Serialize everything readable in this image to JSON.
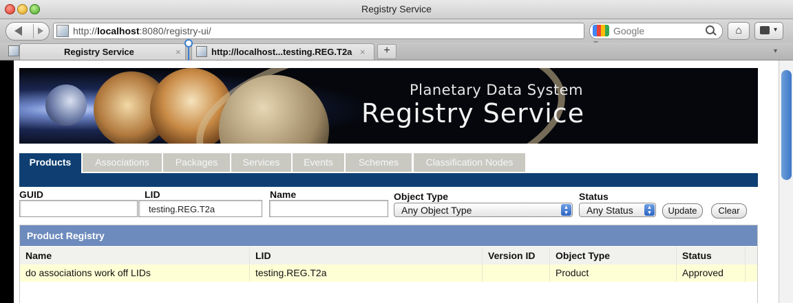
{
  "window": {
    "title": "Registry Service"
  },
  "nav": {
    "url_prefix": "http://",
    "url_host": "localhost",
    "url_rest": ":8080/registry-ui/",
    "search_placeholder": "Google",
    "icons": [
      "back-icon",
      "forward-icon",
      "favicon",
      "star-icon",
      "reload-icon",
      "google-icon",
      "search-icon",
      "home-icon",
      "extension-icon"
    ]
  },
  "browser_tabs": [
    {
      "label": "Registry Service",
      "close": "×"
    },
    {
      "label": "http://localhost...testing.REG.T2a",
      "close": "×"
    }
  ],
  "new_tab": "+",
  "banner": {
    "subtitle": "Planetary Data System",
    "title": "Registry Service"
  },
  "app_tabs": [
    "Products",
    "Associations",
    "Packages",
    "Services",
    "Events",
    "Schemes",
    "Classification Nodes"
  ],
  "colors": {
    "nav_blue": "#0f3f72",
    "panel_header": "#6d8bbd",
    "inactive_tab": "#c9c9c2",
    "row_highlight": "#ffffd6"
  },
  "filters": {
    "guid_label": "GUID",
    "guid_value": "",
    "lid_label": "LID",
    "lid_value": "testing.REG.T2a",
    "name_label": "Name",
    "name_value": "",
    "object_type_label": "Object Type",
    "object_type_value": "Any Object Type",
    "status_label": "Status",
    "status_value": "Any Status",
    "update_label": "Update",
    "clear_label": "Clear"
  },
  "registry": {
    "title": "Product Registry",
    "columns": [
      "Name",
      "LID",
      "Version ID",
      "Object Type",
      "Status"
    ],
    "rows": [
      {
        "name": "do associations work off LIDs",
        "lid": "testing.REG.T2a",
        "version": "",
        "object_type": "Product",
        "status": "Approved"
      }
    ]
  }
}
